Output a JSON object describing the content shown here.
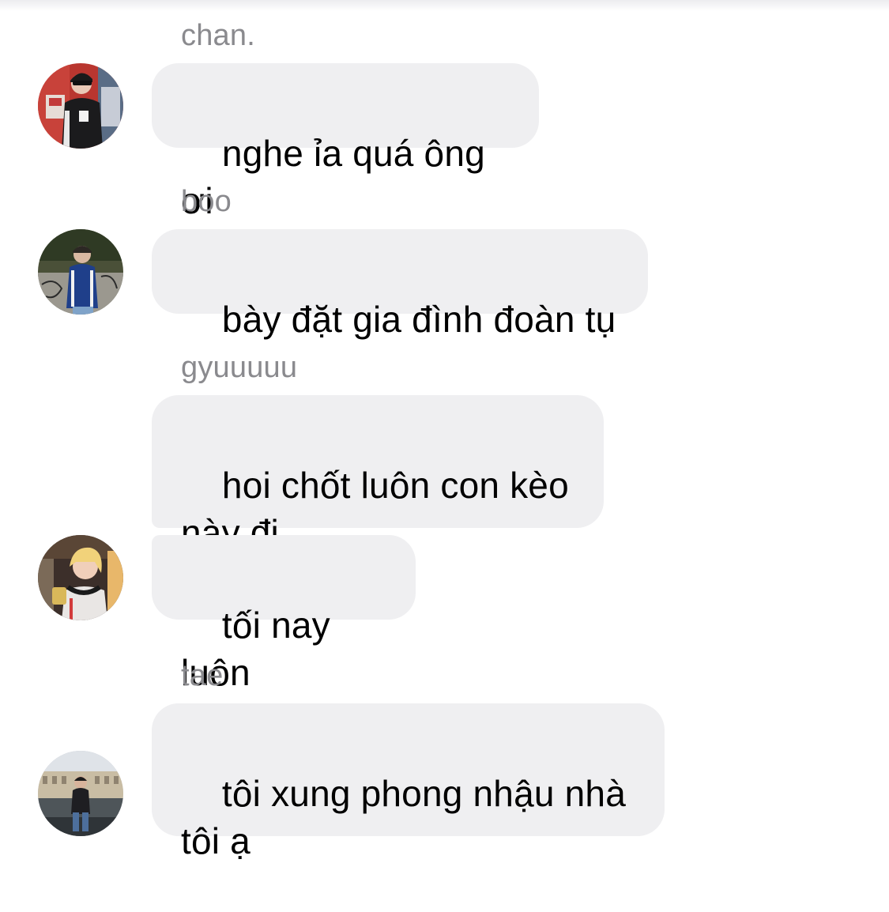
{
  "messages": [
    {
      "sender": "chan.",
      "lines": [
        "nghe ỉa quá ông ơi"
      ],
      "avatar": "chan-avatar"
    },
    {
      "sender": "boo",
      "lines": [
        "bày đặt gia đình đoàn tụ"
      ],
      "avatar": "boo-avatar"
    },
    {
      "sender": "gyuuuuu",
      "lines": [
        "hoi chốt luôn con kèo\nnày đi",
        "tối nay luôn"
      ],
      "avatar": "gyu-avatar"
    },
    {
      "sender": "tae",
      "lines": [
        "tôi xung phong nhậu nhà\ntôi ạ"
      ],
      "avatar": "tae-avatar"
    }
  ],
  "colors": {
    "bubble": "#efeff1",
    "sender_text": "#8a8a8e",
    "message_text": "#000000",
    "background": "#ffffff"
  }
}
